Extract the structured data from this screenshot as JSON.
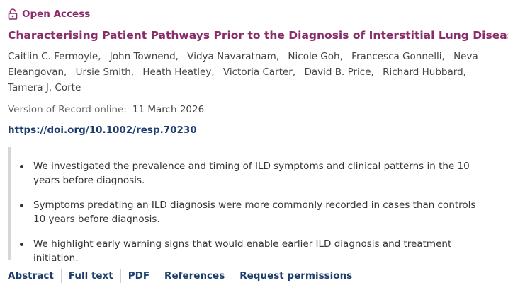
{
  "article": {
    "access_label": "Open Access",
    "title": "Characterising Patient Pathways Prior to the Diagnosis of Interstitial Lung Disease",
    "authors": [
      "Caitlin C. Fermoyle,",
      "John Townend,",
      "Vidya Navaratnam,",
      "Nicole Goh,",
      "Francesca Gonnelli,",
      "Neva Eleangovan,",
      "Ursie Smith,",
      "Heath Heatley,",
      "Victoria Carter,",
      "David B. Price,",
      "Richard Hubbard,",
      "Tamera J. Corte"
    ],
    "vor_label": "Version of Record online:",
    "vor_date": "11 March 2026",
    "doi": "https://doi.org/10.1002/resp.70230",
    "highlights": [
      "We investigated the prevalence and timing of ILD symptoms and clinical patterns in the 10 years before diagnosis.",
      "Symptoms predating an ILD diagnosis were more commonly recorded in cases than controls 10 years before diagnosis.",
      "We highlight early warning signs that would enable earlier ILD diagnosis and treatment initiation."
    ]
  },
  "links": {
    "abstract": "Abstract",
    "full_text": "Full text",
    "pdf": "PDF",
    "references": "References",
    "request_permissions": "Request permissions"
  },
  "colors": {
    "accent": "#8a2c6b",
    "link": "#1d3d6f"
  },
  "icons": {
    "open_access": "open-lock-icon"
  }
}
